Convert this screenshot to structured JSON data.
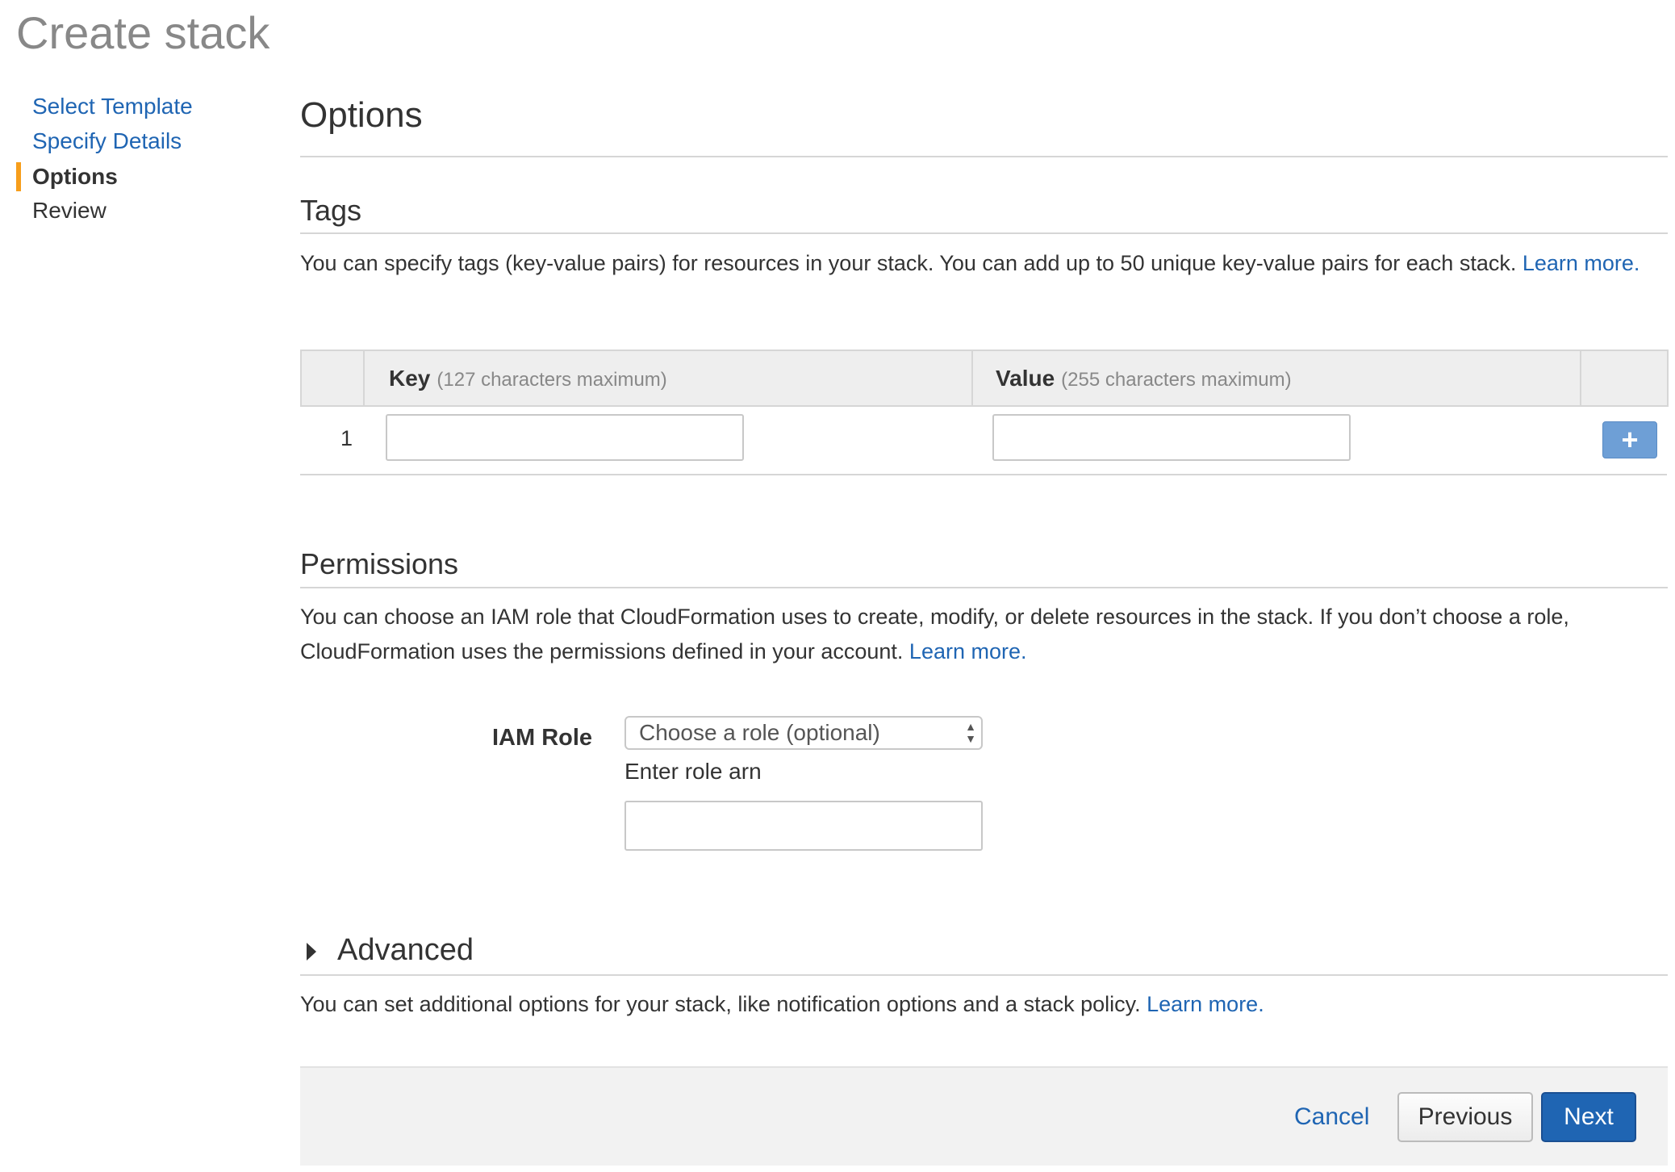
{
  "page": {
    "title": "Create stack"
  },
  "wizard": {
    "steps": [
      {
        "label": "Select Template",
        "state": "link"
      },
      {
        "label": "Specify Details",
        "state": "link"
      },
      {
        "label": "Options",
        "state": "current"
      },
      {
        "label": "Review",
        "state": "upcoming"
      }
    ],
    "accent_color": "#f79e1b"
  },
  "options": {
    "title": "Options",
    "tags": {
      "title": "Tags",
      "description": "You can specify tags (key-value pairs) for resources in your stack. You can add up to 50 unique key-value pairs for each stack.",
      "learn_more": "Learn more.",
      "columns": {
        "key_label": "Key",
        "key_hint": "(127 characters maximum)",
        "value_label": "Value",
        "value_hint": "(255 characters maximum)"
      },
      "rows": [
        {
          "index": "1",
          "key": "",
          "value": ""
        }
      ],
      "add_button": "+"
    },
    "permissions": {
      "title": "Permissions",
      "description": "You can choose an IAM role that CloudFormation uses to create, modify, or delete resources in the stack. If you don’t choose a role, CloudFormation uses the permissions defined in your account.",
      "learn_more": "Learn more.",
      "iam_role_label": "IAM Role",
      "role_select_value": "Choose a role (optional)",
      "role_arn_label": "Enter role arn",
      "role_arn_value": ""
    },
    "advanced": {
      "title": "Advanced",
      "description": "You can set additional options for your stack, like notification options and a stack policy.",
      "learn_more": "Learn more."
    }
  },
  "footer": {
    "cancel": "Cancel",
    "previous": "Previous",
    "next": "Next"
  },
  "colors": {
    "link": "#1f65b3",
    "primary_button": "#1f65b3",
    "add_button": "#6e9fd6"
  }
}
